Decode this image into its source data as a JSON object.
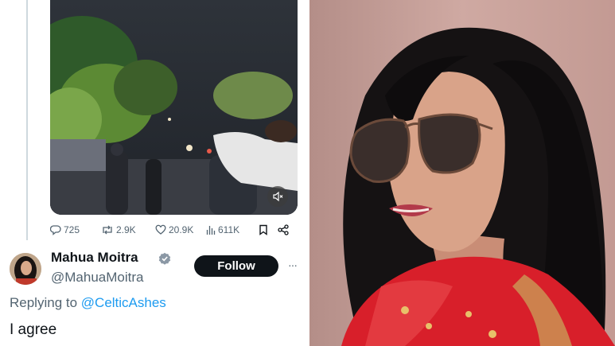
{
  "tweet": {
    "metrics": {
      "replies": "725",
      "retweets": "2.9K",
      "likes": "20.9K",
      "views": "611K"
    },
    "author": {
      "display_name": "Mahua Moitra",
      "handle": "@MahuaMoitra"
    },
    "follow_label": "Follow",
    "more_label": "···",
    "replying_prefix": "Replying to ",
    "replying_to": "@CelticAshes",
    "text": "I agree"
  },
  "colors": {
    "accent": "#1d9bf0",
    "text_primary": "#0f1419",
    "text_secondary": "#536471",
    "saree_red": "#d81f2a"
  },
  "icons": [
    "reply-icon",
    "retweet-icon",
    "like-icon",
    "views-icon",
    "bookmark-icon",
    "share-icon",
    "verified-badge-icon",
    "mute-icon"
  ]
}
